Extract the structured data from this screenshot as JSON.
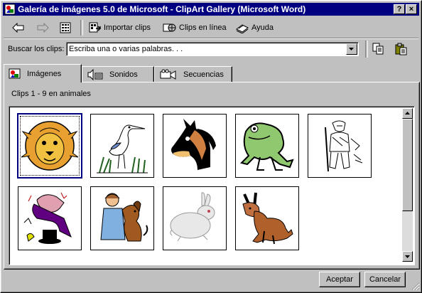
{
  "window": {
    "title": "Galería de imágenes 5.0 de Microsoft - ClipArt Gallery (Microsoft Word)"
  },
  "titlebar": {
    "help_glyph": "?",
    "close_glyph": "×"
  },
  "toolbar": {
    "import_label": "Importar clips",
    "online_label": "Clips en línea",
    "help_label": "Ayuda"
  },
  "search": {
    "label": "Buscar los clips:",
    "placeholder": "Escriba una o varias palabras. . ."
  },
  "tabs": [
    {
      "label": "Imágenes",
      "active": true
    },
    {
      "label": "Sonidos",
      "active": false
    },
    {
      "label": "Secuencias",
      "active": false
    }
  ],
  "clips_caption": "Clips 1 - 9 en animales",
  "clips": [
    {
      "name": "lion",
      "selected": true
    },
    {
      "name": "heron"
    },
    {
      "name": "horse"
    },
    {
      "name": "frog"
    },
    {
      "name": "hunter"
    },
    {
      "name": "magician"
    },
    {
      "name": "girl-with-dog"
    },
    {
      "name": "rabbit"
    },
    {
      "name": "donkey"
    }
  ],
  "buttons": {
    "accept": "Aceptar",
    "cancel": "Cancelar"
  },
  "colors": {
    "titlebar": "#000080",
    "face": "#c0c0c0"
  }
}
